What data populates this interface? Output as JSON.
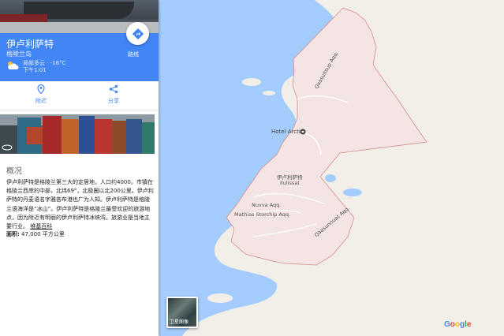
{
  "place": {
    "title": "伊卢利萨特",
    "subtitle": "格陵兰岛",
    "weather": "局部多云 · -16°C",
    "time": "下午1:01",
    "route_label": "路线"
  },
  "actions": [
    {
      "label": "附近",
      "icon": "location-pin-icon"
    },
    {
      "label": "分享",
      "icon": "share-icon"
    }
  ],
  "overview": {
    "heading": "概况",
    "text": "伊卢利萨特是格陵兰第三大的定居地，人口约4000。市镇在格陵兰西岸的中部，北纬69°，北极圈以北200公里。伊卢利萨特的丹麦语名字雅各布港也广为人知。伊卢利萨特是格陵兰语海洋是“冰山”。伊卢利萨特是格陵兰最受欢迎的旅游地点，因为附近有明丽的伊卢利萨特冰峡湾。旅游业是当地主要行业。",
    "link": "维基百科",
    "area_label": "面积:",
    "area_value": "47,000 平方公里"
  },
  "map": {
    "hotel": "Hotel Arctic",
    "town_cn": "伊卢利萨特",
    "town_en": "Ilulissat",
    "road1": "Mathias Storchip Aqq.",
    "road2": "Nuvva Aqq.",
    "road3": "Qaasuitsup Aqq.",
    "road4": "Qaasunnuat Aqq.",
    "satellite_label": "卫星图像",
    "logo": "Google"
  },
  "colors": {
    "header_blue": "#4285f4",
    "water": "#a4cdfd",
    "land": "#f2efe9",
    "town": "#f4e4e4",
    "boundary": "#d88c8c"
  }
}
